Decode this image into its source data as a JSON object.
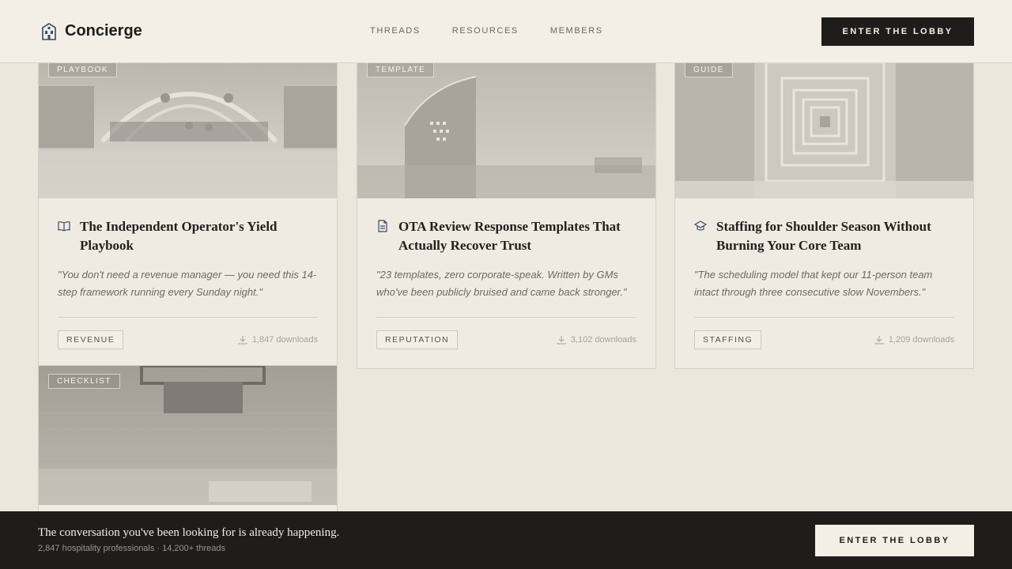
{
  "header": {
    "brand": "Concierge",
    "nav": [
      "THREADS",
      "RESOURCES",
      "MEMBERS"
    ],
    "cta": "ENTER THE LOBBY"
  },
  "cards": [
    {
      "tag": "PLAYBOOK",
      "icon": "book-icon",
      "title": "The Independent Operator's Yield Playbook",
      "quote": "\"You don't need a revenue manager — you need this 14-step framework running every Sunday night.\"",
      "category": "REVENUE",
      "downloads": "1,847 downloads"
    },
    {
      "tag": "TEMPLATE",
      "icon": "document-icon",
      "title": "OTA Review Response Templates That Actually Recover Trust",
      "quote": "\"23 templates, zero corporate-speak. Written by GMs who've been publicly bruised and came back stronger.\"",
      "category": "REPUTATION",
      "downloads": "3,102 downloads"
    },
    {
      "tag": "GUIDE",
      "icon": "graduation-cap-icon",
      "title": "Staffing for Shoulder Season Without Burning Your Core Team",
      "quote": "\"The scheduling model that kept our 11-person team intact through three consecutive slow Novembers.\"",
      "category": "STAFFING",
      "downloads": "1,209 downloads"
    },
    {
      "tag": "CHECKLIST"
    }
  ],
  "bottom_bar": {
    "headline": "The conversation you've been looking for is already happening.",
    "stats": "2,847 hospitality professionals · 14,200+ threads",
    "cta": "ENTER THE LOBBY"
  }
}
